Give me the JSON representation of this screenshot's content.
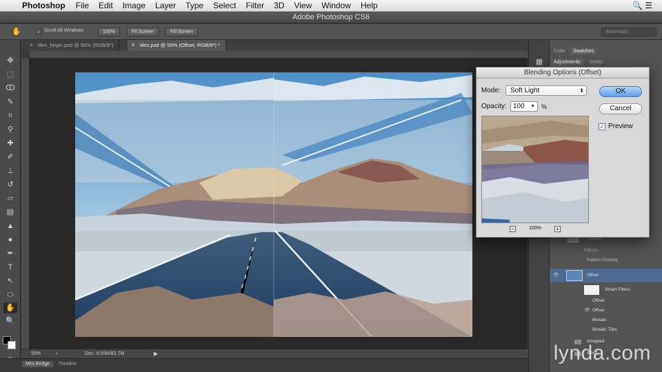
{
  "menubar": {
    "app_name": "Photoshop",
    "items": [
      "File",
      "Edit",
      "Image",
      "Layer",
      "Type",
      "Select",
      "Filter",
      "3D",
      "View",
      "Window",
      "Help"
    ]
  },
  "window": {
    "title": "Adobe Photoshop CS6"
  },
  "options_bar": {
    "scroll_all_label": "Scroll All Windows",
    "btn_100": "100%",
    "btn_fit": "Fit Screen",
    "btn_fill": "Fill Screen",
    "workspace": "Essentials"
  },
  "doc_tabs": [
    {
      "label": "tiles_begin.psd @ 50% (RGB/8*)"
    },
    {
      "label": "tiles.psd @ 50% (Offset, RGB/8*) *"
    }
  ],
  "status": {
    "zoom": "50%",
    "doc_info": "Doc: 4.50M/82.7M"
  },
  "bottom_tabs": [
    "Mini Bridge",
    "Timeline"
  ],
  "panels": {
    "top_tabs": [
      "Color",
      "Swatches"
    ],
    "second_tabs": [
      "Adjustments",
      "Styles"
    ],
    "layers": [
      {
        "label": "Pattern"
      },
      {
        "label": "Effects"
      },
      {
        "label": "Pattern Overlay"
      },
      {
        "label": "Offset"
      },
      {
        "label": "Smart Filters"
      },
      {
        "label": "Offset"
      },
      {
        "label": "Offset"
      },
      {
        "label": "Mosaic"
      },
      {
        "label": "Mosaic Tiles"
      },
      {
        "label": "chopped"
      },
      {
        "label": "diced"
      }
    ]
  },
  "dialog": {
    "title": "Blending Options (Offset)",
    "mode_label": "Mode:",
    "mode_value": "Soft Light",
    "opacity_label": "Opacity:",
    "opacity_value": "100",
    "opacity_unit": "%",
    "ok_label": "OK",
    "cancel_label": "Cancel",
    "preview_label": "Preview",
    "preview_checked": true,
    "zoom_value": "100%"
  },
  "watermark": "lynda.com"
}
